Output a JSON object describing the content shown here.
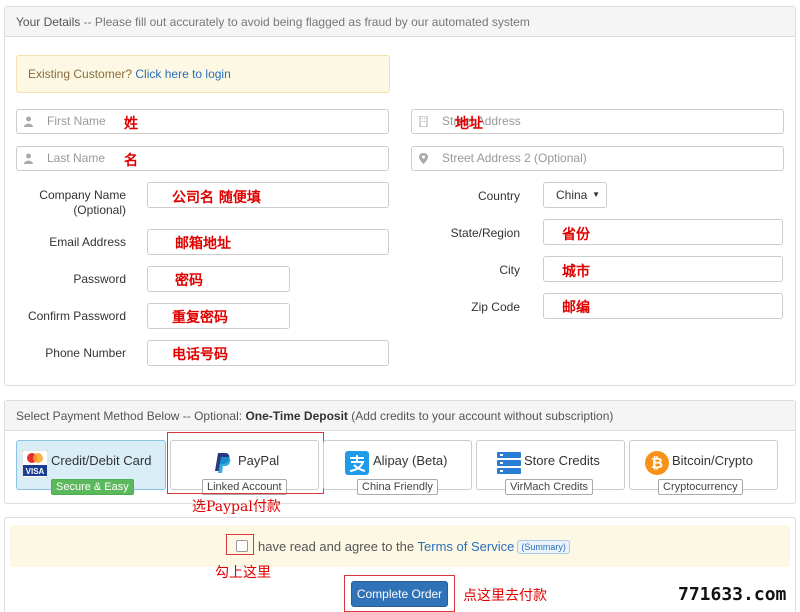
{
  "details": {
    "heading": "Your Details",
    "heading_note": "-- Please fill out accurately to avoid being flagged as fraud by our automated system",
    "existing_customer_text": "Existing Customer?",
    "login_link": "Click here to login",
    "first_name_ph": "First Name",
    "last_name_ph": "Last Name",
    "street_ph": "Street Address",
    "street2_ph": "Street Address 2 (Optional)",
    "company_label_1": "Company Name",
    "company_label_2": "(Optional)",
    "email_label": "Email Address",
    "password_label": "Password",
    "confirm_label": "Confirm Password",
    "phone_label": "Phone Number",
    "country_label": "Country",
    "country_value": "China",
    "state_label": "State/Region",
    "city_label": "City",
    "zip_label": "Zip Code"
  },
  "annotations": {
    "first_name": "姓",
    "last_name": "名",
    "street": "地址",
    "company": "公司名 随便填",
    "email": "邮箱地址",
    "password": "密码",
    "confirm": "重复密码",
    "phone": "电话号码",
    "state": "省份",
    "city": "城市",
    "zip": "邮编",
    "paypal": "选Paypal付款",
    "checkbox": "勾上这里",
    "order": "点这里去付款"
  },
  "payment": {
    "heading_start": "Select Payment Method Below -- Optional:",
    "heading_bold": "One-Time Deposit",
    "heading_end": "(Add credits to your account without subscription)",
    "methods": [
      {
        "title": "Credit/Debit Card",
        "sub": "Secure & Easy"
      },
      {
        "title": "PayPal",
        "sub": "Linked Account"
      },
      {
        "title": "Alipay (Beta)",
        "sub": "China Friendly"
      },
      {
        "title": "Store Credits",
        "sub": "VirMach Credits"
      },
      {
        "title": "Bitcoin/Crypto",
        "sub": "Cryptocurrency"
      }
    ]
  },
  "order": {
    "agree_text": "have read and agree to the",
    "tos_link": "Terms of Service",
    "summary_badge": "(Summary)",
    "complete_button": "Complete Order"
  },
  "watermark": "771633.com",
  "colors": {
    "annotation_red": "#e00000",
    "primary_button": "#2f72b7",
    "notice_bg": "#fcf8e3"
  }
}
